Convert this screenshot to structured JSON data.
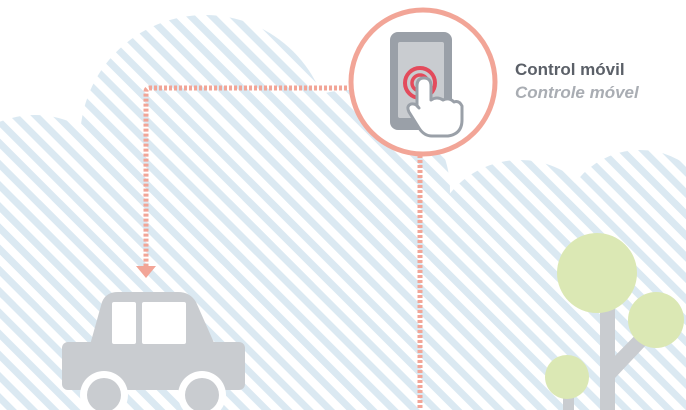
{
  "feature": {
    "title": "Control móvil",
    "subtitle": "Controle móvel",
    "icon": "phone-touch-icon"
  },
  "colors": {
    "connector": "#f2a597",
    "circle_border": "#f2a597",
    "cloud_stripes": "#dbe9f2",
    "vehicle": "#c9ccd0",
    "tree_foliage": "#dbe8b4",
    "tree_trunk": "#c9ccd0",
    "phone_body": "#9aa0a8",
    "touch_rings": "#e34b5c",
    "title_text": "#5b6068",
    "subtitle_text": "#a9adb3"
  },
  "icons": {
    "vehicle": "car-icon",
    "tree": "tree-icon",
    "hand": "hand-pointer-icon"
  }
}
